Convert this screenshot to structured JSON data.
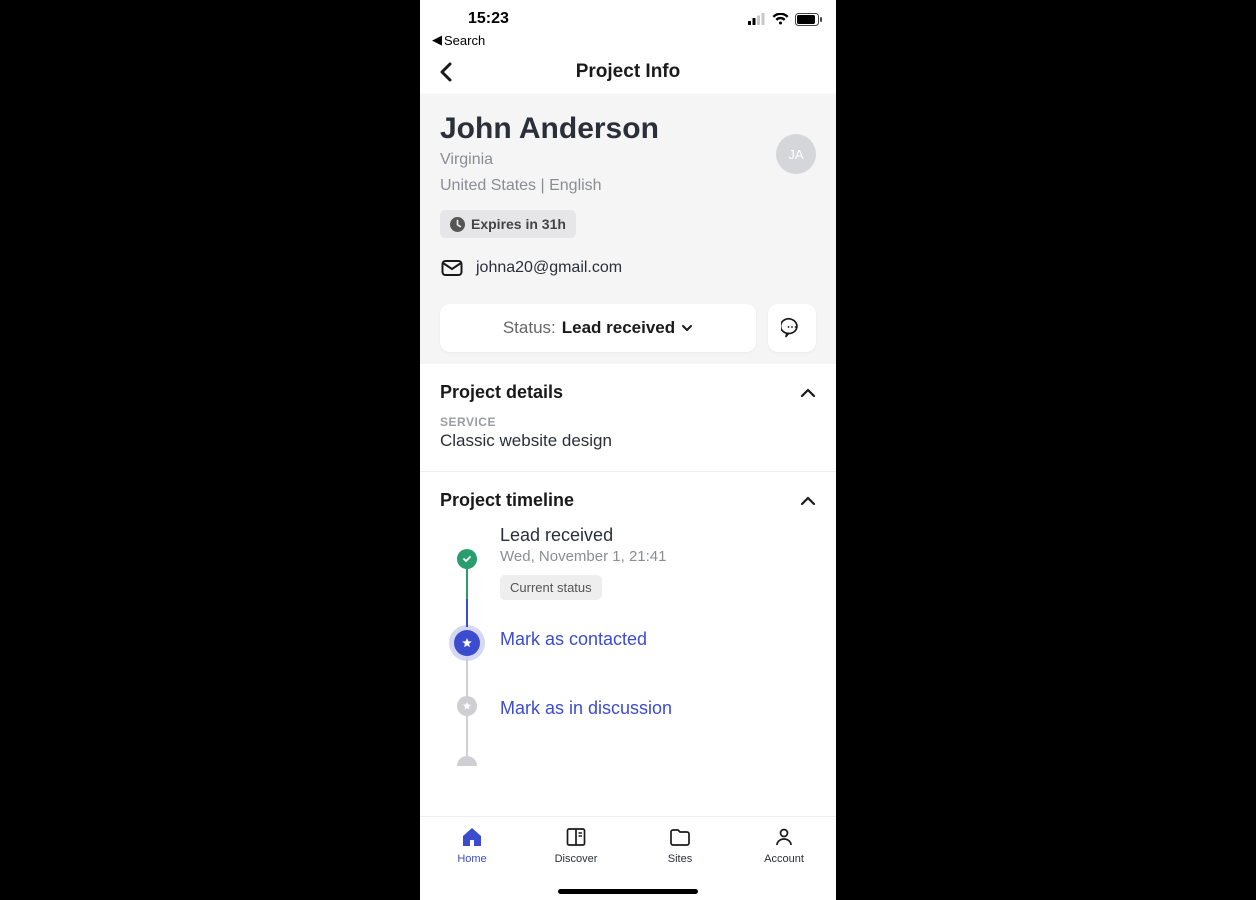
{
  "statusBar": {
    "time": "15:23",
    "backSearch": "Search"
  },
  "nav": {
    "title": "Project Info"
  },
  "person": {
    "name": "John Anderson",
    "region": "Virginia",
    "countryLang": "United States | English",
    "initials": "JA"
  },
  "expireBadge": "Expires in 31h",
  "email": "johna20@gmail.com",
  "status": {
    "label": "Status: ",
    "value": "Lead received"
  },
  "sections": {
    "details": {
      "title": "Project details",
      "serviceLabel": "SERVICE",
      "serviceValue": "Classic website design"
    },
    "timeline": {
      "title": "Project timeline",
      "items": [
        {
          "title": "Lead received",
          "subtitle": "Wed, November 1, 21:41",
          "badge": "Current status"
        },
        {
          "title": "Mark as contacted"
        },
        {
          "title": "Mark as in discussion"
        }
      ]
    }
  },
  "tabs": {
    "home": "Home",
    "discover": "Discover",
    "sites": "Sites",
    "account": "Account"
  }
}
